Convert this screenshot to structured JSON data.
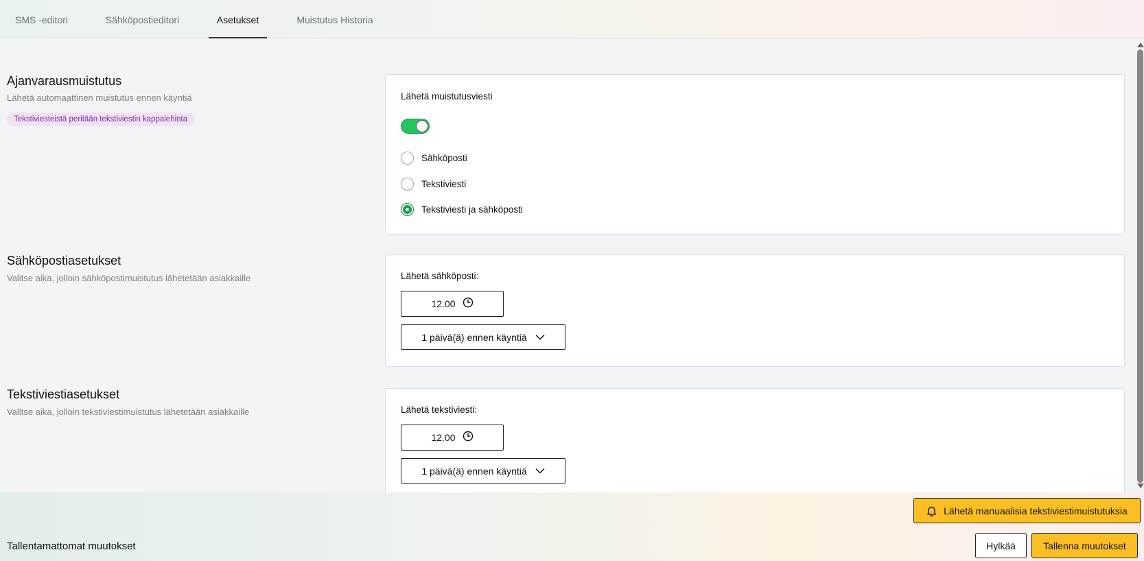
{
  "tabs": [
    {
      "label": "SMS -editori",
      "active": false
    },
    {
      "label": "Sähköpostieditori",
      "active": false
    },
    {
      "label": "Asetukset",
      "active": true
    },
    {
      "label": "Muistutus Historia",
      "active": false
    }
  ],
  "reminder": {
    "title": "Ajanvarausmuistutus",
    "description": "Lähetä automaattinen muistutus ennen käyntiä",
    "badge": "Tekstiviesteistä peritään tekstiviestin kappalehinta",
    "card_label": "Lähetä muistutusviesti",
    "toggle_on": true,
    "options": [
      {
        "label": "Sähköposti",
        "checked": false
      },
      {
        "label": "Tekstiviesti",
        "checked": false
      },
      {
        "label": "Tekstiviesti ja sähköposti",
        "checked": true
      }
    ]
  },
  "email": {
    "title": "Sähköpostiasetukset",
    "description": "Valitse aika, jolloin sähköpostimuistutus lähetetään asiakkaille",
    "card_label": "Lähetä sähköposti:",
    "time": "12.00",
    "offset": "1 päivä(ä) ennen käyntiä"
  },
  "sms": {
    "title": "Tekstiviestiasetukset",
    "description": "Valitse aika, jolloin tekstiviestimuistutus lähetetään asiakkaille",
    "card_label": "Lähetä tekstiviesti:",
    "time": "12.00",
    "offset": "1 päivä(ä) ennen käyntiä"
  },
  "footer": {
    "manual_button": "Lähetä manuaalisia tekstiviestimuistutuksia",
    "unsaved_text": "Tallentamattomat muutokset",
    "cancel_button": "Hylkää",
    "save_button": "Tallenna muutokset"
  },
  "colors": {
    "toggle_on": "#22c55e",
    "radio_checked": "#16a34a",
    "accent_button": "#fbbf24",
    "badge_bg": "#efe3f3",
    "badge_text": "#7a2aa0"
  }
}
